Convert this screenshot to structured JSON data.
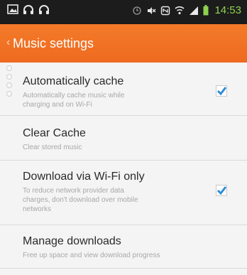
{
  "status_bar": {
    "time": "14:53",
    "icons": [
      "image-icon",
      "headphones-icon",
      "headphones-icon",
      "alarm-icon",
      "mute-icon",
      "nfc-icon",
      "wifi-icon",
      "signal-icon",
      "battery-icon"
    ]
  },
  "app_bar": {
    "back_icon": "chevron-left-icon",
    "title": "Music settings"
  },
  "settings": [
    {
      "title": "Automatically cache",
      "subtitle": [
        "Automatically cache music while",
        "charging and on Wi-Fi"
      ],
      "checked": true
    },
    {
      "title": "Clear Cache",
      "subtitle": [
        "Clear stored music"
      ],
      "checked": null
    },
    {
      "title": "Download via Wi-Fi only",
      "subtitle": [
        "To reduce network provider data",
        "charges, don't download over mobile",
        "networks"
      ],
      "checked": true
    },
    {
      "title": "Manage downloads",
      "subtitle": [
        "Free up space and view download progress"
      ],
      "checked": null
    }
  ],
  "colors": {
    "accent": "#ef6c1f",
    "checkbox": "#2f8ed6",
    "status_bar": "#1c1c1c"
  }
}
